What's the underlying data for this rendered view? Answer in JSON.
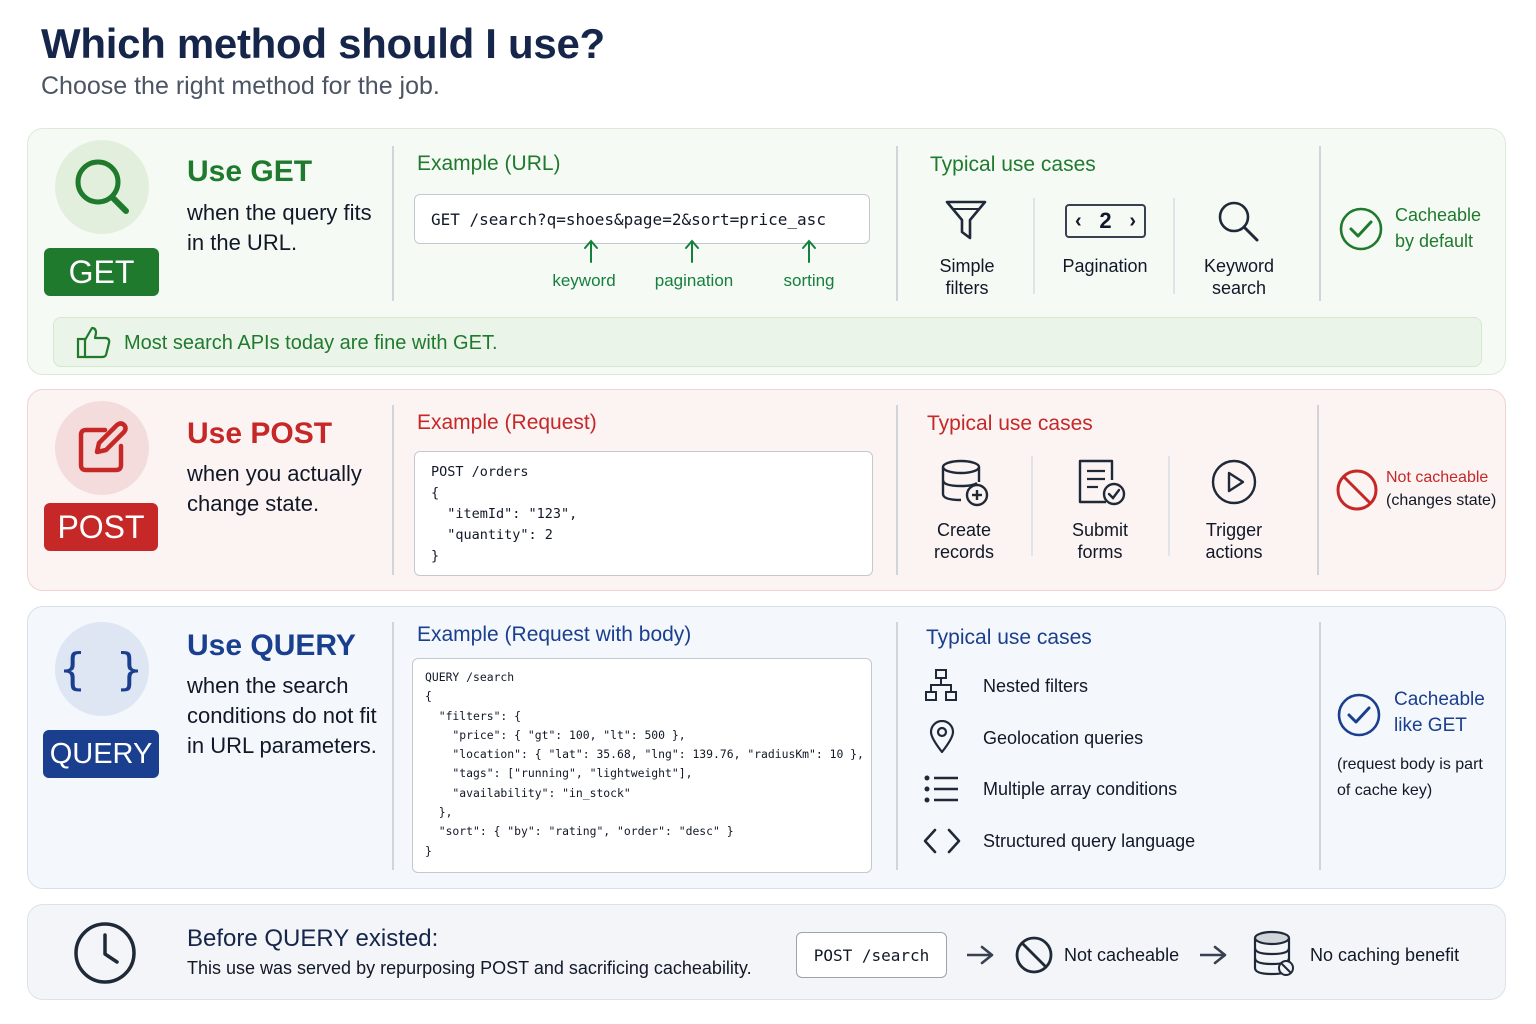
{
  "header": {
    "title": "Which method should I use?",
    "subtitle": "Choose the right method for the job."
  },
  "colors": {
    "get": "#1f7a2e",
    "post": "#c62828",
    "query": "#1a3f8f",
    "ink": "#16264a"
  },
  "get": {
    "icon": "search-icon",
    "badge": "GET",
    "title": "Use GET",
    "desc": "when the query fits in the URL.",
    "example_label": "Example (URL)",
    "example_code": "GET /search?q=shoes&page=2&sort=price_asc",
    "annotations": [
      "keyword",
      "pagination",
      "sorting"
    ],
    "use_cases_label": "Typical use cases",
    "use_cases": [
      {
        "icon": "filter-icon",
        "label": "Simple filters"
      },
      {
        "icon": "pagination-icon",
        "label": "Pagination",
        "icon_text": "2"
      },
      {
        "icon": "search-icon",
        "label": "Keyword search"
      }
    ],
    "cache_icon": "check-circle-icon",
    "cache_text": "Cacheable by default",
    "tip_icon": "thumbs-up-icon",
    "tip": "Most search APIs today are fine with GET."
  },
  "post": {
    "icon": "edit-icon",
    "badge": "POST",
    "title": "Use POST",
    "desc": "when you actually change state.",
    "example_label": "Example (Request)",
    "example_code": "POST /orders\n{\n  \"itemId\": \"123\",\n  \"quantity\": 2\n}",
    "use_cases_label": "Typical use cases",
    "use_cases": [
      {
        "icon": "database-add-icon",
        "label": "Create records"
      },
      {
        "icon": "form-check-icon",
        "label": "Submit forms"
      },
      {
        "icon": "play-circle-icon",
        "label": "Trigger actions"
      }
    ],
    "cache_icon": "no-entry-icon",
    "cache_text": "Not cacheable",
    "cache_note": "(changes state)"
  },
  "query": {
    "icon": "braces-icon",
    "icon_text": "{ }",
    "badge": "QUERY",
    "title": "Use QUERY",
    "desc": "when the search conditions do not fit in URL parameters.",
    "example_label": "Example (Request with body)",
    "example_code": "QUERY /search\n{\n  \"filters\": {\n    \"price\": { \"gt\": 100, \"lt\": 500 },\n    \"location\": { \"lat\": 35.68, \"lng\": 139.76, \"radiusKm\": 10 },\n    \"tags\": [\"running\", \"lightweight\"],\n    \"availability\": \"in_stock\"\n  },\n  \"sort\": { \"by\": \"rating\", \"order\": \"desc\" }\n}",
    "use_cases_label": "Typical use cases",
    "use_cases": [
      {
        "icon": "hierarchy-icon",
        "label": "Nested filters"
      },
      {
        "icon": "location-pin-icon",
        "label": "Geolocation queries"
      },
      {
        "icon": "list-icon",
        "label": "Multiple array conditions"
      },
      {
        "icon": "code-icon",
        "label": "Structured query language"
      }
    ],
    "cache_icon": "check-circle-icon",
    "cache_text": "Cacheable like GET",
    "cache_note": "(request body is part of cache key)"
  },
  "before": {
    "icon": "clock-icon",
    "title": "Before QUERY existed:",
    "desc": "This use was served by repurposing POST and sacrificing cacheability.",
    "flow": [
      {
        "type": "code",
        "text": "POST /search"
      },
      {
        "type": "arrow"
      },
      {
        "type": "label",
        "icon": "no-entry-icon",
        "text": "Not cacheable"
      },
      {
        "type": "arrow"
      },
      {
        "type": "label",
        "icon": "database-icon",
        "text": "No caching benefit"
      }
    ]
  }
}
